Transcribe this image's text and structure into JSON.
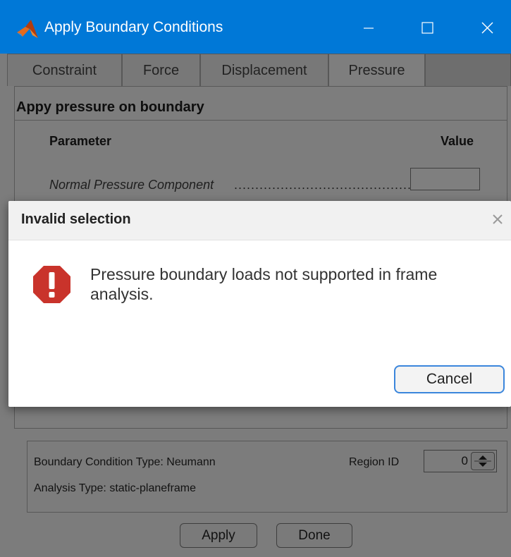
{
  "window": {
    "title": "Apply Boundary Conditions",
    "title_bar_color": "#0078d7",
    "controls": [
      "minimize-icon",
      "maximize-icon",
      "close-icon"
    ]
  },
  "tabs": [
    {
      "label": "Constraint",
      "active": false
    },
    {
      "label": "Force",
      "active": false
    },
    {
      "label": "Displacement",
      "active": false
    },
    {
      "label": "Pressure",
      "active": true
    }
  ],
  "panel": {
    "title": "Appy pressure on boundary",
    "parameter_header": "Parameter",
    "value_header": "Value",
    "rows": [
      {
        "label": "Normal Pressure Component",
        "value": ""
      }
    ]
  },
  "info": {
    "bc_type": "Boundary Condition Type:  Neumann",
    "analysis_type": "Analysis Type:   static-planeframe",
    "region_label": "Region ID",
    "region_value": "0"
  },
  "buttons": {
    "apply": "Apply",
    "done": "Done"
  },
  "alert": {
    "title": "Invalid selection",
    "message": "Pressure boundary loads not supported in frame analysis.",
    "cancel": "Cancel",
    "icon": "error-icon",
    "icon_color": "#c9332b",
    "focus_color": "#3b86dc"
  }
}
